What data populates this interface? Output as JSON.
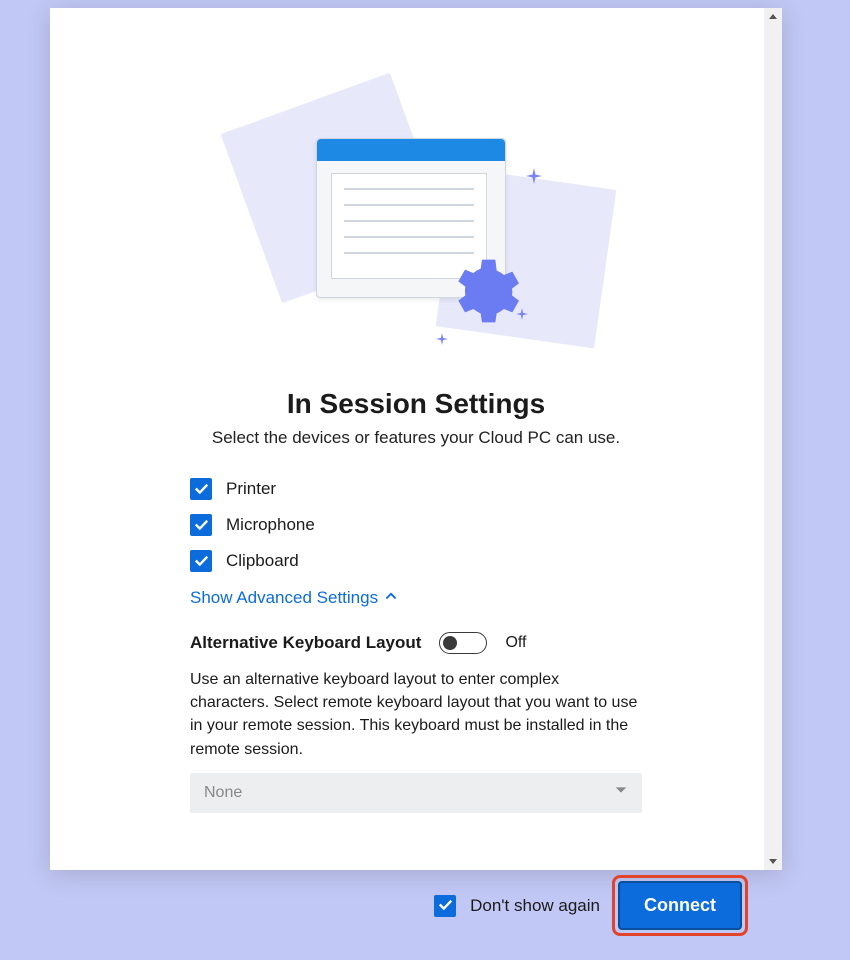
{
  "dialog": {
    "title": "In Session Settings",
    "subtitle": "Select the devices or features your Cloud PC can use.",
    "options": [
      {
        "label": "Printer",
        "checked": true
      },
      {
        "label": "Microphone",
        "checked": true
      },
      {
        "label": "Clipboard",
        "checked": true
      }
    ],
    "advanced_link": "Show Advanced Settings",
    "alt_kb": {
      "label": "Alternative Keyboard Layout",
      "state": "Off",
      "description": "Use an alternative keyboard layout to enter complex characters. Select remote keyboard layout that you want to use in your remote session. This keyboard must be installed in the remote session.",
      "select_value": "None"
    },
    "footer": {
      "dont_show_label": "Don't show again",
      "dont_show_checked": true,
      "connect_label": "Connect"
    }
  }
}
